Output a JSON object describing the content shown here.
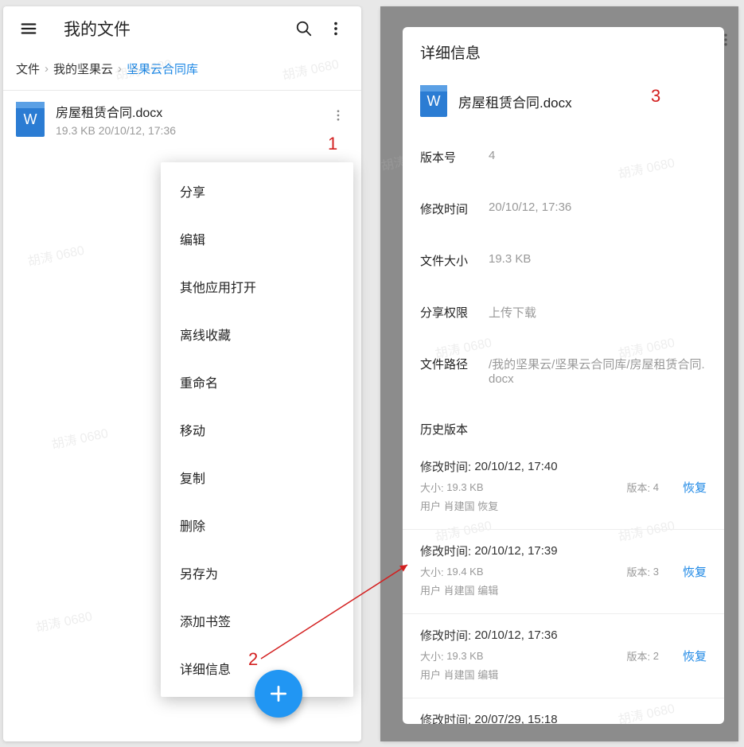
{
  "left": {
    "header_title": "我的文件",
    "breadcrumb": {
      "part1": "文件",
      "part2": "我的坚果云",
      "part3": "坚果云合同库"
    },
    "file": {
      "icon_letter": "W",
      "name": "房屋租赁合同.docx",
      "meta": "19.3 KB 20/10/12, 17:36"
    },
    "menu": {
      "items": [
        {
          "label": "分享"
        },
        {
          "label": "编辑"
        },
        {
          "label": "其他应用打开"
        },
        {
          "label": "离线收藏"
        },
        {
          "label": "重命名"
        },
        {
          "label": "移动"
        },
        {
          "label": "复制"
        },
        {
          "label": "删除"
        },
        {
          "label": "另存为"
        },
        {
          "label": "添加书签"
        },
        {
          "label": "详细信息"
        }
      ]
    }
  },
  "right": {
    "details_title": "详细信息",
    "file": {
      "icon_letter": "W",
      "name": "房屋租赁合同.docx"
    },
    "info": {
      "version_label": "版本号",
      "version_value": "4",
      "mtime_label": "修改时间",
      "mtime_value": "20/10/12, 17:36",
      "size_label": "文件大小",
      "size_value": "19.3 KB",
      "perm_label": "分享权限",
      "perm_value": "上传下载",
      "path_label": "文件路径",
      "path_value": "/我的坚果云/坚果云合同库/房屋租赁合同.docx"
    },
    "history_title": "历史版本",
    "history": [
      {
        "time_label": "修改时间:",
        "time": "20/10/12, 17:40",
        "size_label": "大小:",
        "size": "19.3 KB",
        "ver_label": "版本:",
        "ver": "4",
        "user_label": "用户",
        "user": "肖建国",
        "action": "恢复",
        "restore": "恢复"
      },
      {
        "time_label": "修改时间:",
        "time": "20/10/12, 17:39",
        "size_label": "大小:",
        "size": "19.4 KB",
        "ver_label": "版本:",
        "ver": "3",
        "user_label": "用户",
        "user": "肖建国",
        "action": "编辑",
        "restore": "恢复"
      },
      {
        "time_label": "修改时间:",
        "time": "20/10/12, 17:36",
        "size_label": "大小:",
        "size": "19.3 KB",
        "ver_label": "版本:",
        "ver": "2",
        "user_label": "用户",
        "user": "肖建国",
        "action": "编辑",
        "restore": "恢复"
      },
      {
        "time_label": "修改时间:",
        "time": "20/07/29, 15:18",
        "size_label": "",
        "size": "",
        "ver_label": "",
        "ver": "",
        "user_label": "",
        "user": "",
        "action": "",
        "restore": ""
      }
    ]
  },
  "annotations": {
    "n1": "1",
    "n2": "2",
    "n3": "3"
  },
  "watermark": "胡涛 0680"
}
